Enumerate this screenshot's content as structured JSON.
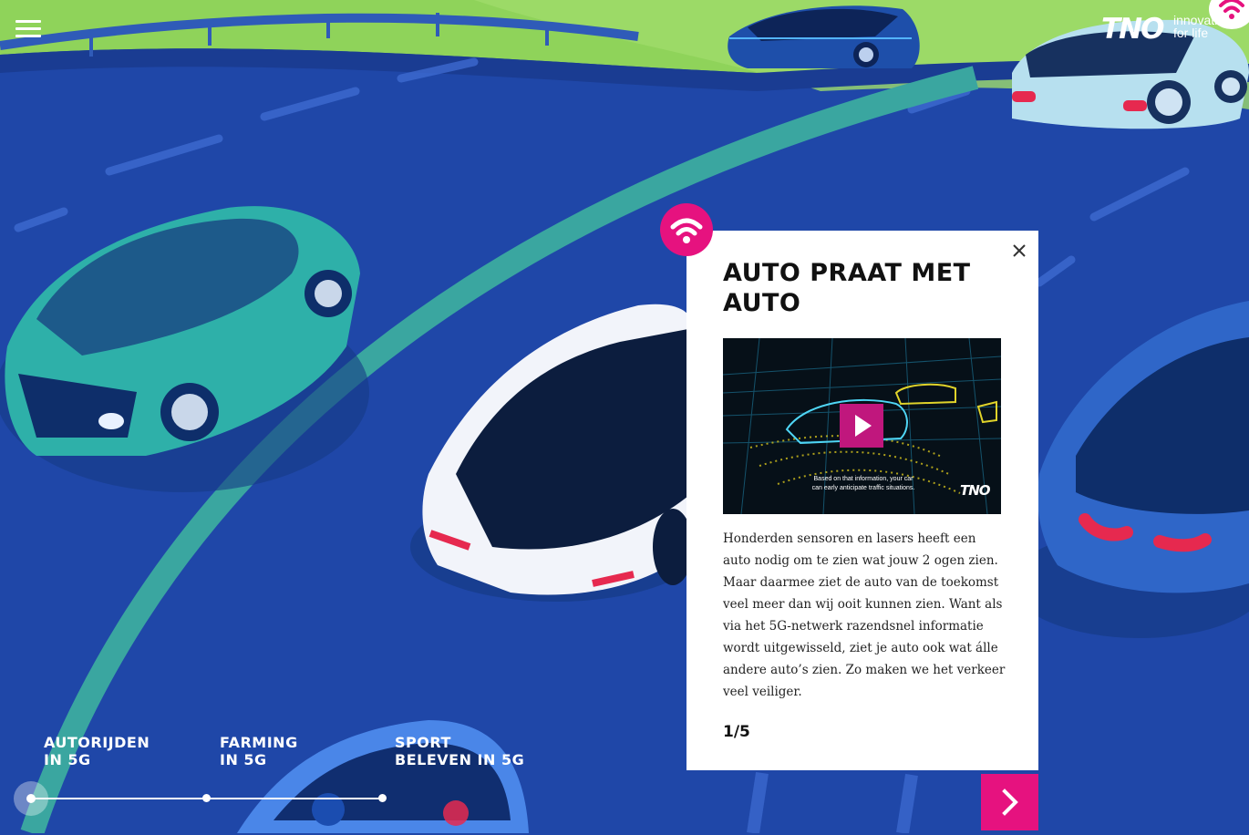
{
  "brand": {
    "logo": "TNO",
    "tagline_1": "innovation",
    "tagline_2": "for life"
  },
  "popup": {
    "title": "AUTO PRAAT MET AUTO",
    "video_caption": "Based on that information, your car can early anticipate traffic situations.",
    "video_logo": "TNO",
    "body": "Honderden sensoren en lasers heeft een auto nodig om te zien wat jouw 2 ogen zien. Maar daarmee ziet de auto van de toekomst veel meer dan wij ooit kunnen zien. Want als via het 5G-netwerk razendsnel informatie wordt uitgewisseld, ziet je auto ook wat álle andere auto’s zien. Zo maken we het verkeer veel veiliger.",
    "counter": "1/5"
  },
  "timeline": {
    "items": [
      {
        "line1": "AUTORIJDEN",
        "line2": "IN 5G"
      },
      {
        "line1": "FARMING",
        "line2": "IN 5G"
      },
      {
        "line1": "SPORT",
        "line2": "BELEVEN IN 5G"
      }
    ],
    "active_index": 0
  },
  "icons": {
    "menu": "hamburger-menu-icon",
    "wifi": "wifi-icon",
    "close": "close-icon",
    "play": "play-icon",
    "next": "chevron-right-icon"
  },
  "colors": {
    "road": "#1f47a8",
    "grass": "#8fd35a",
    "lane_arc": "#3aa6a0",
    "accent": "#e6127f",
    "popup_bg": "#ffffff"
  }
}
